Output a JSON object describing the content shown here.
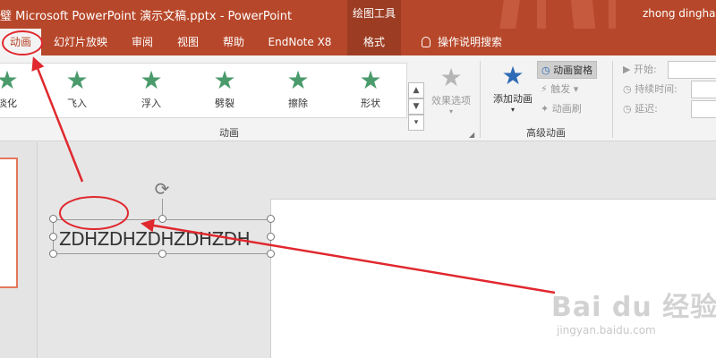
{
  "titlebar": {
    "doc_title": "璧 Microsoft PowerPoint 演示文稿.pptx  -  PowerPoint",
    "drawing_tools": "绘图工具",
    "user": "zhong dinghan"
  },
  "tabs": {
    "animation": "动画",
    "slideshow": "幻灯片放映",
    "review": "审阅",
    "view": "视图",
    "help": "帮助",
    "endnote": "EndNote X8",
    "format": "格式",
    "tell_me": "操作说明搜索"
  },
  "ribbon": {
    "effects": [
      {
        "label": "淡化",
        "glyph": "★",
        "color": "#4a9a6b"
      },
      {
        "label": "飞入",
        "glyph": "★",
        "color": "#4a9a6b"
      },
      {
        "label": "浮入",
        "glyph": "★",
        "color": "#4a9a6b"
      },
      {
        "label": "劈裂",
        "glyph": "★",
        "color": "#4a9a6b"
      },
      {
        "label": "擦除",
        "glyph": "★",
        "color": "#4a9a6b"
      },
      {
        "label": "形状",
        "glyph": "★",
        "color": "#4a9a6b"
      }
    ],
    "effect_options": "效果选项",
    "animation_group": "动画",
    "add_animation": "添加动画",
    "animation_pane": "动画窗格",
    "trigger": "触发",
    "animation_painter": "动画刷",
    "advanced_group": "高级动画",
    "start": "开始:",
    "duration": "持续时间:",
    "delay": "延迟:"
  },
  "slide": {
    "textbox_text": "ZDHZDHZDHZDHZDH"
  },
  "watermark": {
    "main": "Bai du 经验",
    "sub": "jingyan.baidu.com"
  },
  "colors": {
    "accent": "#b7472a",
    "annotation": "#e0282e",
    "effect_star": "#4a9a6b"
  }
}
